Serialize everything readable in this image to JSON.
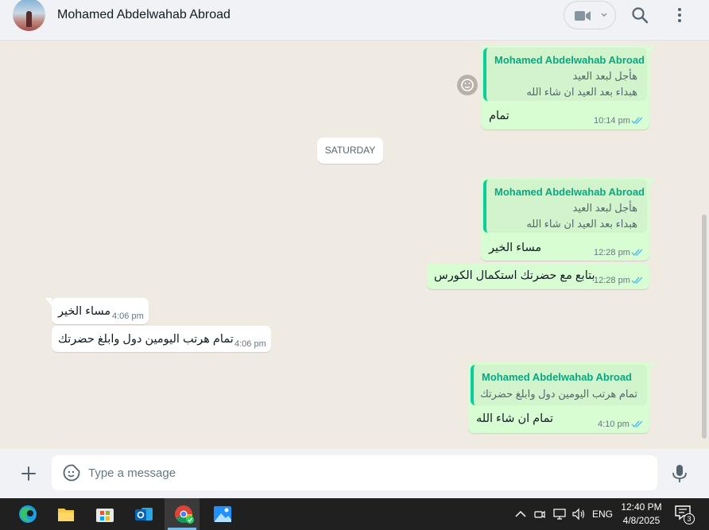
{
  "header": {
    "contact_name": "Mohamed Abdelwahab Abroad",
    "icons": [
      "avatar",
      "video-call-icon",
      "chevron-down-icon",
      "search-icon",
      "more-options-icon"
    ]
  },
  "messages": [
    {
      "direction": "outgoing",
      "quote": {
        "name": "Mohamed Abdelwahab Abroad",
        "line1": "هأجل لبعد العيد",
        "line2": "هبداء بعد العيد ان شاء الله"
      },
      "text": "تمام",
      "time": "10:14 pm",
      "status": "read"
    },
    {
      "type": "date",
      "text": "SATURDAY"
    },
    {
      "direction": "outgoing",
      "quote": {
        "name": "Mohamed Abdelwahab Abroad",
        "line1": "هأجل لبعد العيد",
        "line2": "هبداء بعد العيد ان شاء الله"
      },
      "text": "مساء الخير",
      "time": "12:28 pm",
      "status": "read"
    },
    {
      "direction": "outgoing",
      "text": "بتابع مع حضرتك استكمال الكورس",
      "time": "12:28 pm",
      "status": "read"
    },
    {
      "direction": "incoming",
      "text": "مساء الخير",
      "time": "4:06 pm"
    },
    {
      "direction": "incoming",
      "text": "تمام هرتب اليومين دول وابلغ حضرتك",
      "time": "4:06 pm"
    },
    {
      "direction": "outgoing",
      "quote": {
        "name": "Mohamed Abdelwahab Abroad",
        "line1": "تمام هرتب اليومين دول وابلغ حضرتك"
      },
      "text": "تمام ان شاء الله",
      "time": "4:10 pm",
      "status": "read"
    }
  ],
  "composer": {
    "placeholder": "Type a message",
    "value": ""
  },
  "taskbar": {
    "apps": [
      "edge-icon",
      "file-explorer-icon",
      "store-icon",
      "outlook-icon",
      "chrome-icon",
      "photos-icon"
    ],
    "language": "ENG",
    "time": "12:40 PM",
    "date": "4/8/2025",
    "notification_count": "3"
  },
  "colors": {
    "outgoing_bubble": "#d9fdd3",
    "incoming_bubble": "#ffffff",
    "quote_accent": "#06cf9c",
    "read_ticks": "#53bdeb",
    "chat_background": "#efeae2"
  }
}
